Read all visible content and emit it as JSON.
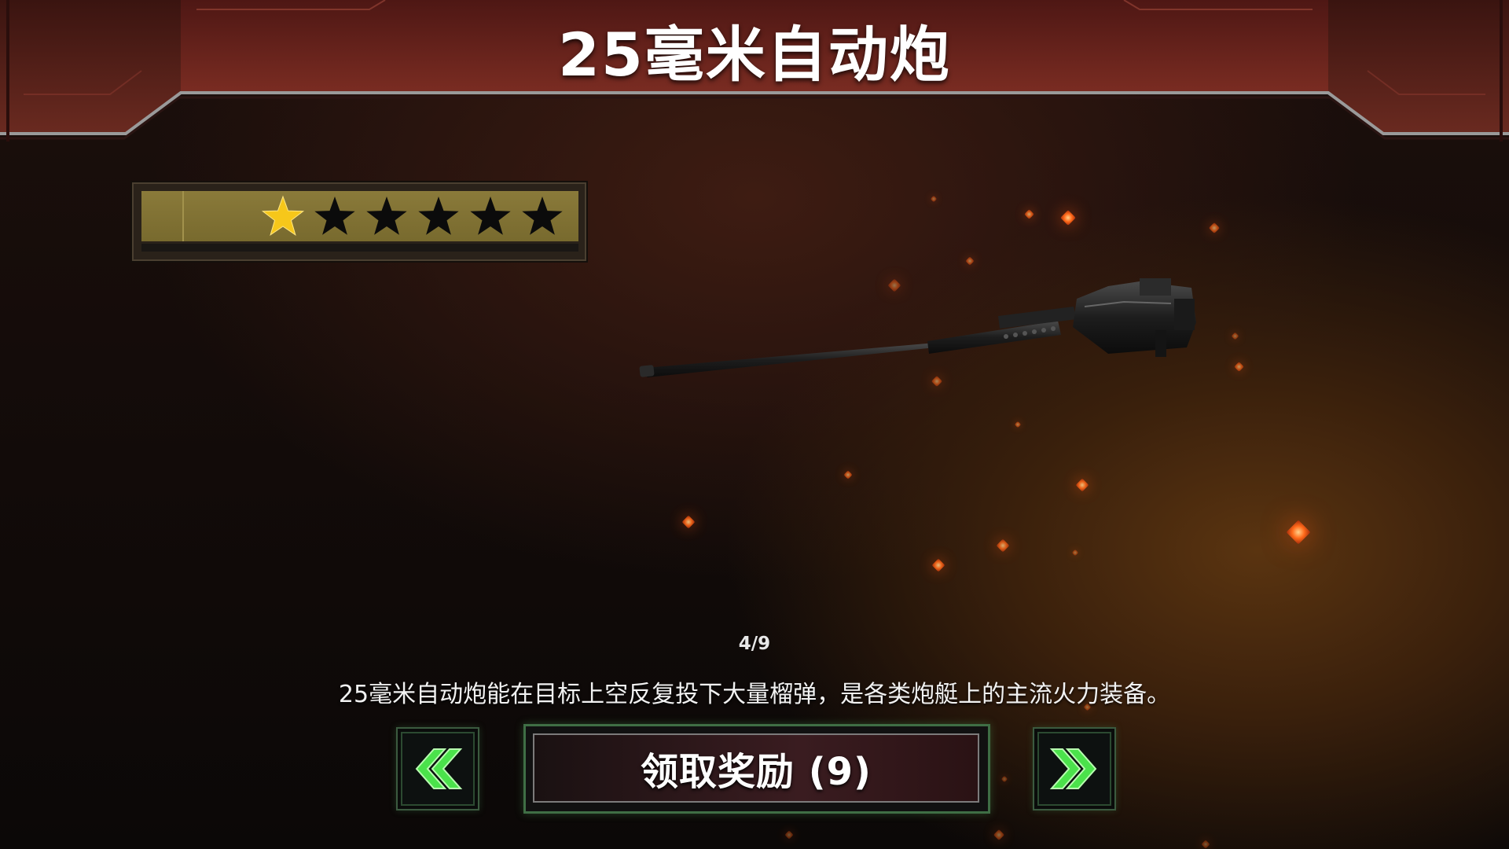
{
  "header": {
    "title": "25毫米自动炮"
  },
  "rating": {
    "filled_stars": 1,
    "total_stars": 6,
    "filled_color": "#f6c71a",
    "empty_color": "#0b0b0b",
    "icon": "star-icon"
  },
  "item": {
    "icon": "autocannon-weapon-image"
  },
  "pager": {
    "counter": "4/9"
  },
  "description": "25毫米自动炮能在目标上空反复投下大量榴弹，是各类炮艇上的主流火力装备。",
  "controls": {
    "prev_icon": "chevron-double-left-icon",
    "next_icon": "chevron-double-right-icon",
    "claim_label": "领取奖励 (9)",
    "accent_color": "#3f6e45"
  }
}
